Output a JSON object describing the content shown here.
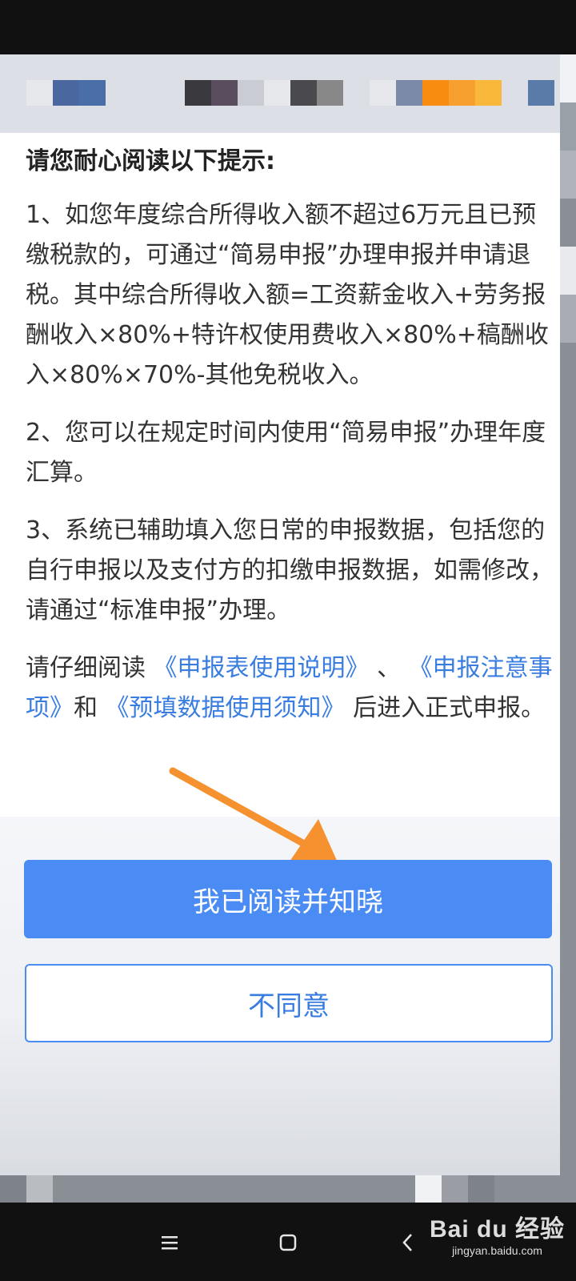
{
  "dialog": {
    "title": "请您耐心阅读以下提示:",
    "paragraphs": [
      "1、如您年度综合所得收入额不超过6万元且已预缴税款的，可通过“简易申报”办理申报并申请退税。其中综合所得收入额=工资薪金收入+劳务报酬收入×80%+特许权使用费收入×80%+稿酬收入×80%×70%-其他免税收入。",
      "2、您可以在规定时间内使用“简易申报”办理年度汇算。",
      "3、系统已辅助填入您日常的申报数据，包括您的自行申报以及支付方的扣缴申报数据，如需修改，请通过“标准申报”办理。"
    ],
    "notice": {
      "prefix": "请仔细阅读 ",
      "link1": "《申报表使用说明》",
      "sep1": " 、 ",
      "link2": "《申报注意事项》",
      "sep2": "和 ",
      "link3": "《预填数据使用须知》",
      "suffix": " 后进入正式申报。"
    },
    "confirm_label": "我已阅读并知晓",
    "decline_label": "不同意"
  },
  "watermark": {
    "logo": "Bai du 经验",
    "url": "jingyan.baidu.com"
  },
  "icons": {
    "menu": "menu-icon",
    "home": "home-icon",
    "back": "back-icon",
    "arrow": "arrow-annotation-icon"
  },
  "colors": {
    "primary_button": "#4a8cf3",
    "link": "#3a7de0",
    "arrow": "#f5922f",
    "top_strip_pixels": [
      "#dcdfe6",
      "#e6e8ec",
      "#4a67a0",
      "#4a6ea8",
      "#dcdfe6",
      "#dcdfe6",
      "#dcdfe6",
      "#3a3a3e",
      "#5a4e5e",
      "#c9ccd2",
      "#e6e8ec",
      "#4a4a4e",
      "#888888",
      "#dcdfe6",
      "#e6e8ec",
      "#7a8aa8",
      "#f78c10",
      "#f7a030",
      "#f9b83a",
      "#dcdfe6",
      "#5a7aa8"
    ]
  }
}
